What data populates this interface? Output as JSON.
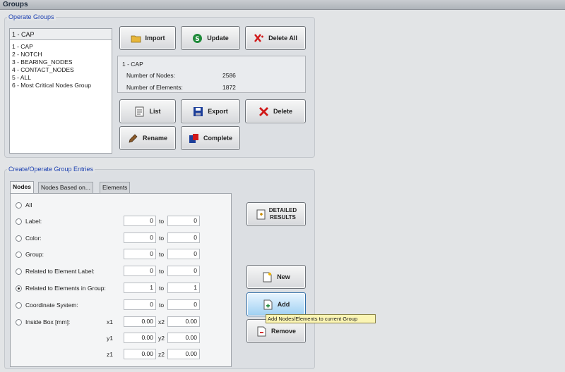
{
  "window": {
    "title": "Groups"
  },
  "operate_groups": {
    "legend": "Operate Groups",
    "selected_header": "1 - CAP",
    "items": [
      "1 - CAP",
      "2 - NOTCH",
      "3 - BEARING_NODES",
      "4 - CONTACT_NODES",
      "5 - ALL",
      "6 - Most Critical Nodes Group"
    ],
    "buttons": {
      "import": "Import",
      "update": "Update",
      "delete_all": "Delete All",
      "list": "List",
      "export": "Export",
      "delete": "Delete",
      "rename": "Rename",
      "complete": "Complete"
    },
    "info": {
      "name": "1 - CAP",
      "nodes_label": "Number of Nodes:",
      "nodes_value": "2586",
      "elements_label": "Number of Elements:",
      "elements_value": "1872"
    }
  },
  "group_entries": {
    "legend": "Create/Operate Group Entries",
    "tabs": [
      "Nodes",
      "Nodes Based on...",
      "Elements"
    ],
    "options": {
      "all": "All",
      "label": "Label:",
      "color": "Color:",
      "group": "Group:",
      "related_label": "Related to Element Label:",
      "related_group": "Related to Elements in Group:",
      "coord": "Coordinate System:",
      "inside_box": "Inside Box [mm]:"
    },
    "to": "to",
    "values": {
      "label_from": "0",
      "label_to": "0",
      "color_from": "0",
      "color_to": "0",
      "group_from": "0",
      "group_to": "0",
      "rel_label_from": "0",
      "rel_label_to": "0",
      "rel_group_from": "1",
      "rel_group_to": "1",
      "coord_from": "0",
      "coord_to": "0"
    },
    "box": {
      "x1_label": "x1",
      "x1": "0.00",
      "x2_label": "x2",
      "x2": "0.00",
      "y1_label": "y1",
      "y1": "0.00",
      "y2_label": "y2",
      "y2": "0.00",
      "z1_label": "z1",
      "z1": "0.00",
      "z2_label": "z2",
      "z2": "0.00"
    },
    "buttons": {
      "detailed_line1": "DETAILED",
      "detailed_line2": "RESULTS",
      "new": "New",
      "add": "Add",
      "remove": "Remove"
    },
    "tooltip": "Add Nodes/Elements to current Group"
  }
}
